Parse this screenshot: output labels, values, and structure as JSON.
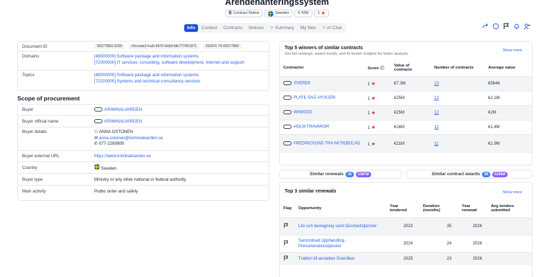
{
  "header": {
    "title": "Ärendehanteringssystem",
    "notice_type": "Contract Notice",
    "country": "Sweden",
    "value": "€ 42M",
    "score": "1"
  },
  "tabs": [
    {
      "label": "Info",
      "active": true
    },
    {
      "label": "Context"
    },
    {
      "label": "Contracts"
    },
    {
      "label": "Notices"
    },
    {
      "label": "Summary"
    },
    {
      "label": "My files"
    },
    {
      "label": "AI Chat"
    }
  ],
  "info": {
    "document_id_label": "Document ID",
    "document_ids": [
      "00277850-2026",
      "c5cceda2-fca5-4970-8c8d-fdb777401971",
      "2026/S 79-00277850"
    ],
    "domains_label": "Domains",
    "domains": [
      "[48000000] Software package and information systems",
      "[72000000] IT services: consulting, software development, Internet and support"
    ],
    "topics_label": "Topics",
    "topics": [
      "[48000000] Software package and information systems",
      "[72220000] Systems and technical consultancy services"
    ]
  },
  "scope": {
    "title": "Scope of procurement",
    "buyer_label": "Buyer",
    "buyer": "KRIMINALVARDEN",
    "official_name_label": "Buyer official name",
    "official_name": "KRIMINALVARDEN",
    "details_label": "Buyer details",
    "contact_name": "ANNA OSTONEN",
    "contact_email": "anna.ostonen@kriminalvarden.se",
    "contact_phone": "077-2280800",
    "url_label": "Buyer external URL",
    "url": "https://www.kriminalvarden.se",
    "country_label": "Country",
    "country": "Sweden",
    "type_label": "Buyer type",
    "type": "Ministry or any other national or federal authority",
    "activity_label": "Main activity",
    "activity": "Public order and safety"
  },
  "winners": {
    "title": "Top 5 winners of similar contracts",
    "subtitle": "Get full rankings, award trends, and AI tender insights for faster analysis.",
    "show_more": "Show more",
    "columns": [
      "Contractor",
      "Score",
      "Value of contracts",
      "Number of contracts",
      "Average value"
    ],
    "rows": [
      {
        "name": "SVEREK",
        "score": "1",
        "value": "€7.3M",
        "count": "13",
        "avg": "€564K"
      },
      {
        "name": "PLATE SAG HYVLERI",
        "score": "1",
        "value": "€25M",
        "count": "12",
        "avg": "€2.1M"
      },
      {
        "name": "WIWOOD",
        "score": "1",
        "value": "€25M",
        "count": "12",
        "avg": "€2M"
      },
      {
        "name": "HOLM TRAVAROR",
        "score": "1",
        "value": "€16M",
        "count": "12",
        "avg": "€1.4M"
      },
      {
        "name": "FREDRICSONS TRA AKTIEBOLAG",
        "score": "1",
        "value": "€21M",
        "count": "11",
        "avg": "€1.9M"
      }
    ]
  },
  "similar": {
    "renewals_label": "Similar renewals",
    "renewals_count": "36",
    "renewals_value": "€387M",
    "awards_label": "Similar contract awards",
    "awards_count": "38",
    "awards_value": "€269M"
  },
  "renewals": {
    "title": "Top 3 similar renewals",
    "show_more": "Show more",
    "columns": [
      "Flag",
      "Opportunity",
      "Year tendered",
      "Duration (months)",
      "Year renewal",
      "Avg tenders submitted"
    ],
    "rows": [
      {
        "opportunity": "Lås och beslagning samt låssmedstjänster",
        "year": "2023",
        "duration": "35",
        "renewal": "2026"
      },
      {
        "opportunity": "Samordnad Upphandling - Prenumerationstjänster",
        "year": "2024",
        "duration": "24",
        "renewal": "2026"
      },
      {
        "opportunity": "Tvätteri till anstalten Österåker",
        "year": "2025",
        "duration": "23",
        "renewal": "2026"
      }
    ]
  }
}
